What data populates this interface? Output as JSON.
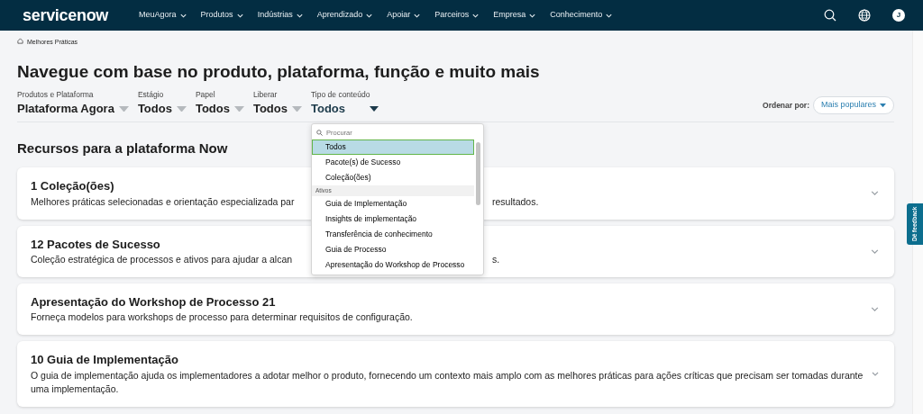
{
  "brand": {
    "logo": "servicenow"
  },
  "nav": [
    {
      "label": "MeuAgora"
    },
    {
      "label": "Produtos"
    },
    {
      "label": "Indústrias"
    },
    {
      "label": "Aprendizado"
    },
    {
      "label": "Apoiar"
    },
    {
      "label": "Parceiros"
    },
    {
      "label": "Empresa"
    },
    {
      "label": "Conhecimento"
    }
  ],
  "avatar": {
    "initial": "J"
  },
  "breadcrumb": "Melhores Práticas",
  "title": "Navegue com base no produto, plataforma, função e muito mais",
  "filters": [
    {
      "label": "Produtos e Plataforma",
      "value": "Plataforma Agora",
      "expanded": false
    },
    {
      "label": "Estágio",
      "value": "Todos",
      "expanded": false
    },
    {
      "label": "Papel",
      "value": "Todos",
      "expanded": false
    },
    {
      "label": "Liberar",
      "value": "Todos",
      "expanded": false
    },
    {
      "label": "Tipo de conteúdo",
      "value": "Todos",
      "expanded": true
    }
  ],
  "sort": {
    "label": "Ordenar por:",
    "value": "Mais populares"
  },
  "dropdown": {
    "placeholder": "Procurar",
    "items": [
      {
        "kind": "option",
        "label": "Todos",
        "selected": true
      },
      {
        "kind": "option",
        "label": "Pacote(s) de Sucesso",
        "selected": false
      },
      {
        "kind": "option",
        "label": "Coleção(ões)",
        "selected": false
      },
      {
        "kind": "group",
        "label": "Ativos"
      },
      {
        "kind": "option",
        "label": "Guia de Implementação",
        "selected": false
      },
      {
        "kind": "option",
        "label": "Insights de implementação",
        "selected": false
      },
      {
        "kind": "option",
        "label": "Transferência de conhecimento",
        "selected": false
      },
      {
        "kind": "option",
        "label": "Guia de Processo",
        "selected": false
      },
      {
        "kind": "option",
        "label": "Apresentação do Workshop de Processo",
        "selected": false
      }
    ]
  },
  "section_title": "Recursos para a plataforma Now",
  "cards": [
    {
      "title": "1 Coleção(ões)",
      "description": [
        "Melhores práticas selecionadas e orientação especializada par",
        "resultados."
      ],
      "expanded": false
    },
    {
      "title": "12 Pacotes de Sucesso",
      "description": [
        "Coleção estratégica de processos e ativos para ajudar a alcan",
        "s."
      ],
      "expanded": false
    },
    {
      "title": "Apresentação do Workshop de Processo 21",
      "description": [
        "Forneça modelos para workshops de processo para determinar requisitos de configuração."
      ],
      "expanded": false
    },
    {
      "title": "10 Guia de Implementação",
      "description": [
        "O guia de implementação ajuda os implementadores a adotar melhor o produto, fornecendo um contexto mais amplo com as melhores práticas para ações críticas que precisam ser tomadas durante uma implementação."
      ],
      "expanded": false
    }
  ],
  "feedback_tab": "Dê feedback"
}
